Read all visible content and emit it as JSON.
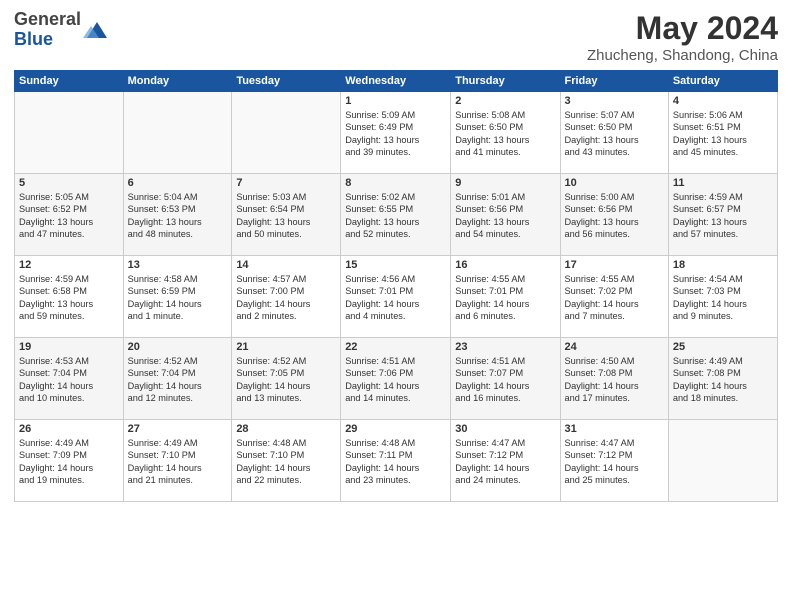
{
  "logo": {
    "general": "General",
    "blue": "Blue"
  },
  "title": "May 2024",
  "subtitle": "Zhucheng, Shandong, China",
  "days": [
    "Sunday",
    "Monday",
    "Tuesday",
    "Wednesday",
    "Thursday",
    "Friday",
    "Saturday"
  ],
  "weeks": [
    [
      {
        "num": "",
        "info": ""
      },
      {
        "num": "",
        "info": ""
      },
      {
        "num": "",
        "info": ""
      },
      {
        "num": "1",
        "info": "Sunrise: 5:09 AM\nSunset: 6:49 PM\nDaylight: 13 hours\nand 39 minutes."
      },
      {
        "num": "2",
        "info": "Sunrise: 5:08 AM\nSunset: 6:50 PM\nDaylight: 13 hours\nand 41 minutes."
      },
      {
        "num": "3",
        "info": "Sunrise: 5:07 AM\nSunset: 6:50 PM\nDaylight: 13 hours\nand 43 minutes."
      },
      {
        "num": "4",
        "info": "Sunrise: 5:06 AM\nSunset: 6:51 PM\nDaylight: 13 hours\nand 45 minutes."
      }
    ],
    [
      {
        "num": "5",
        "info": "Sunrise: 5:05 AM\nSunset: 6:52 PM\nDaylight: 13 hours\nand 47 minutes."
      },
      {
        "num": "6",
        "info": "Sunrise: 5:04 AM\nSunset: 6:53 PM\nDaylight: 13 hours\nand 48 minutes."
      },
      {
        "num": "7",
        "info": "Sunrise: 5:03 AM\nSunset: 6:54 PM\nDaylight: 13 hours\nand 50 minutes."
      },
      {
        "num": "8",
        "info": "Sunrise: 5:02 AM\nSunset: 6:55 PM\nDaylight: 13 hours\nand 52 minutes."
      },
      {
        "num": "9",
        "info": "Sunrise: 5:01 AM\nSunset: 6:56 PM\nDaylight: 13 hours\nand 54 minutes."
      },
      {
        "num": "10",
        "info": "Sunrise: 5:00 AM\nSunset: 6:56 PM\nDaylight: 13 hours\nand 56 minutes."
      },
      {
        "num": "11",
        "info": "Sunrise: 4:59 AM\nSunset: 6:57 PM\nDaylight: 13 hours\nand 57 minutes."
      }
    ],
    [
      {
        "num": "12",
        "info": "Sunrise: 4:59 AM\nSunset: 6:58 PM\nDaylight: 13 hours\nand 59 minutes."
      },
      {
        "num": "13",
        "info": "Sunrise: 4:58 AM\nSunset: 6:59 PM\nDaylight: 14 hours\nand 1 minute."
      },
      {
        "num": "14",
        "info": "Sunrise: 4:57 AM\nSunset: 7:00 PM\nDaylight: 14 hours\nand 2 minutes."
      },
      {
        "num": "15",
        "info": "Sunrise: 4:56 AM\nSunset: 7:01 PM\nDaylight: 14 hours\nand 4 minutes."
      },
      {
        "num": "16",
        "info": "Sunrise: 4:55 AM\nSunset: 7:01 PM\nDaylight: 14 hours\nand 6 minutes."
      },
      {
        "num": "17",
        "info": "Sunrise: 4:55 AM\nSunset: 7:02 PM\nDaylight: 14 hours\nand 7 minutes."
      },
      {
        "num": "18",
        "info": "Sunrise: 4:54 AM\nSunset: 7:03 PM\nDaylight: 14 hours\nand 9 minutes."
      }
    ],
    [
      {
        "num": "19",
        "info": "Sunrise: 4:53 AM\nSunset: 7:04 PM\nDaylight: 14 hours\nand 10 minutes."
      },
      {
        "num": "20",
        "info": "Sunrise: 4:52 AM\nSunset: 7:04 PM\nDaylight: 14 hours\nand 12 minutes."
      },
      {
        "num": "21",
        "info": "Sunrise: 4:52 AM\nSunset: 7:05 PM\nDaylight: 14 hours\nand 13 minutes."
      },
      {
        "num": "22",
        "info": "Sunrise: 4:51 AM\nSunset: 7:06 PM\nDaylight: 14 hours\nand 14 minutes."
      },
      {
        "num": "23",
        "info": "Sunrise: 4:51 AM\nSunset: 7:07 PM\nDaylight: 14 hours\nand 16 minutes."
      },
      {
        "num": "24",
        "info": "Sunrise: 4:50 AM\nSunset: 7:08 PM\nDaylight: 14 hours\nand 17 minutes."
      },
      {
        "num": "25",
        "info": "Sunrise: 4:49 AM\nSunset: 7:08 PM\nDaylight: 14 hours\nand 18 minutes."
      }
    ],
    [
      {
        "num": "26",
        "info": "Sunrise: 4:49 AM\nSunset: 7:09 PM\nDaylight: 14 hours\nand 19 minutes."
      },
      {
        "num": "27",
        "info": "Sunrise: 4:49 AM\nSunset: 7:10 PM\nDaylight: 14 hours\nand 21 minutes."
      },
      {
        "num": "28",
        "info": "Sunrise: 4:48 AM\nSunset: 7:10 PM\nDaylight: 14 hours\nand 22 minutes."
      },
      {
        "num": "29",
        "info": "Sunrise: 4:48 AM\nSunset: 7:11 PM\nDaylight: 14 hours\nand 23 minutes."
      },
      {
        "num": "30",
        "info": "Sunrise: 4:47 AM\nSunset: 7:12 PM\nDaylight: 14 hours\nand 24 minutes."
      },
      {
        "num": "31",
        "info": "Sunrise: 4:47 AM\nSunset: 7:12 PM\nDaylight: 14 hours\nand 25 minutes."
      },
      {
        "num": "",
        "info": ""
      }
    ]
  ]
}
